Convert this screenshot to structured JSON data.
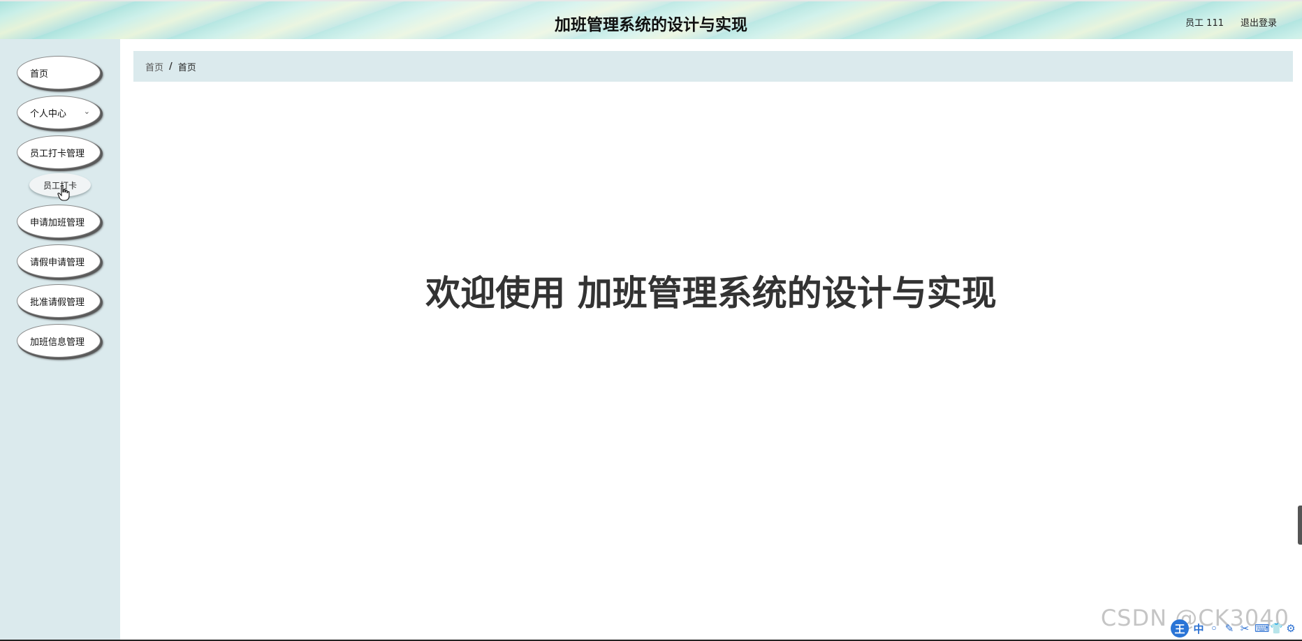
{
  "header": {
    "title": "加班管理系统的设计与实现",
    "user": "员工 111",
    "logout": "退出登录"
  },
  "sidebar": {
    "items": [
      {
        "label": "首页"
      },
      {
        "label": "个人中心",
        "has_chevron": true
      },
      {
        "label": "员工打卡管理"
      },
      {
        "label": "申请加班管理"
      },
      {
        "label": "请假申请管理"
      },
      {
        "label": "批准请假管理"
      },
      {
        "label": "加班信息管理"
      }
    ],
    "submenu": [
      {
        "label": "员工打卡"
      }
    ],
    "chevron": "⌄"
  },
  "breadcrumb": {
    "first": "首页",
    "separator": "/",
    "current": "首页"
  },
  "main": {
    "welcome": "欢迎使用 加班管理系统的设计与实现"
  },
  "watermark": "CSDN @CK3040",
  "ime": {
    "logo": "王",
    "glyphs": [
      "中",
      "◦",
      "✎",
      "✂",
      "⌨",
      "👕",
      "⚙"
    ]
  },
  "colors": {
    "sidebar_bg": "#dbeaed",
    "breadcrumb_bg": "#dbeaed",
    "ime_blue": "#2a74d6"
  }
}
